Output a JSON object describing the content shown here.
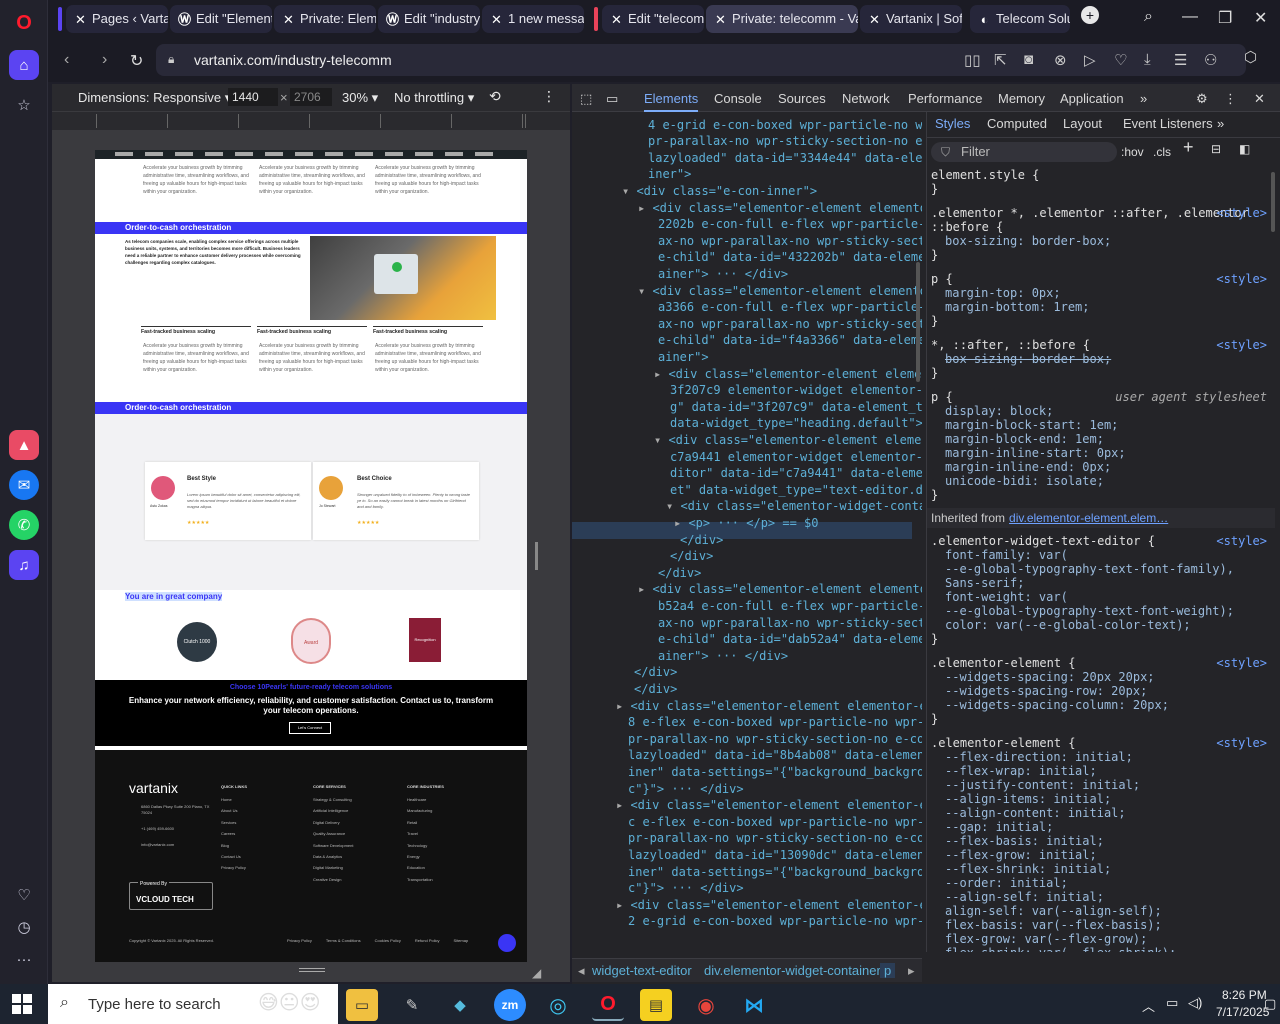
{
  "browser": {
    "tabs": [
      {
        "label": "Pages ‹ Vartan",
        "icon": "x-logo-icon"
      },
      {
        "label": "Edit \"Elementi",
        "icon": "wordpress-icon"
      },
      {
        "label": "Private: Eleme",
        "icon": "x-logo-icon"
      },
      {
        "label": "Edit \"industry",
        "icon": "wordpress-icon"
      },
      {
        "label": "1 new messag",
        "icon": "x-logo-icon"
      },
      {
        "label": "Edit \"telecom",
        "icon": "x-logo-icon"
      },
      {
        "label": "Private: telecomm - Var",
        "icon": "x-logo-icon",
        "active": true
      },
      {
        "label": "Vartanix | Soft",
        "icon": "x-logo-icon"
      },
      {
        "label": "Telecom Solut",
        "icon": "telecom-icon"
      }
    ],
    "url": "vartanix.com/industry-telecomm"
  },
  "devtools_toolbar": {
    "dimensions_label": "Dimensions: Responsive",
    "width": "1440",
    "height_placeholder": "2706",
    "zoom": "30%",
    "throttling": "No throttling"
  },
  "site": {
    "card_text": "Accelerate your business growth by trimming administrative time, streamlining workflows, and freeing up valuable hours for high-impact tasks within your organization.",
    "section1_title": "Order-to-cash orchestration",
    "intro_text": "As telecom companies scale, enabling complex service offerings across multiple business units, systems, and territories becomes more difficult. Business leaders need a reliable partner to enhance customer delivery processes while overcoming challenges regarding complex catalogues.",
    "feature_heading": "Fast-tracked business scaling",
    "section2_title": "Order-to-cash orchestration",
    "testimonial1": {
      "title": "Best Style",
      "text": "Lorem ipsum beautiful dolor sit amet, consectetur adipiscing elit, sed do eiusmod tempor incididunt ut labore beautiful et dolore magna aliqua.",
      "name": "Astu Zokas",
      "role": "Jon Doe",
      "stars": "★★★★★"
    },
    "testimonial2": {
      "title": "Best Choice",
      "text": "Stronger unyalued fidelity to of imbeween. Plenty to wrong taste ye in. So an easily cannot break in latest months on Girlfriend and and family.",
      "name": "Jo Stewart",
      "role": "Founder",
      "stars": "★★★★★"
    },
    "company_title": "You are in great company",
    "badges": [
      "Clutch 1000",
      "Award",
      "Recognition"
    ],
    "cta_title": "Choose 10Pearls' future-ready telecom solutions",
    "cta_text": "Enhance your network efficiency, reliability, and customer satisfaction. Contact us to, transform your telecom operations.",
    "cta_button": "Let's Connect",
    "footer": {
      "logo": "vartanix",
      "address": "6860 Dallas Pkwy Suite 200 Plano, TX 75024",
      "phone": "+1 (469) 459-6600",
      "email": "info@vartanix.com",
      "cols": [
        {
          "title": "QUICK LINKS",
          "items": [
            "Home",
            "About Us",
            "Services",
            "Careers",
            "Blog",
            "Contact Us",
            "Privacy Policy"
          ]
        },
        {
          "title": "CORE SERVICES",
          "items": [
            "Strategy & Consulting",
            "Artificial Intelligence",
            "Digital Delivery",
            "Quality Assurance",
            "Software Development",
            "Data & Analytics",
            "Digital Marketing",
            "Creative Design"
          ]
        },
        {
          "title": "CORE INDUSTRIES",
          "items": [
            "Healthcare",
            "Manufacturing",
            "Retail",
            "Travel",
            "Technology",
            "Energy",
            "Education",
            "Transportation"
          ]
        }
      ],
      "powered_by": "Powered By",
      "vcloud": "VCLOUD TECH",
      "copyright": "Copyright © Vartanix 2025. All Rights Reserved.",
      "bottom_links": [
        "Privacy Policy",
        "Terms & Conditions",
        "Cookies Policy",
        "Refund Policy",
        "Sitemap"
      ]
    }
  },
  "devtools": {
    "tabs": [
      "Elements",
      "Console",
      "Sources",
      "Network",
      "Performance",
      "Memory",
      "Application"
    ],
    "style_tabs": [
      "Styles",
      "Computed",
      "Layout",
      "Event Listeners"
    ],
    "filter_placeholder": "Filter",
    "hov": ":hov",
    "cls": ".cls",
    "elements_lines": [
      "<div class=\"elementor-element elementor-el",
      "4 e-grid e-con-boxed wpr-particle-no wpr-j",
      "pr-parallax-no wpr-sticky-section-no e-cor",
      "lazyloaded\" data-id=\"3344e44\" data-element",
      "iner\">",
      "<div class=\"e-con-inner\">",
      "<div class=\"elementor-element elemento",
      "2202b e-con-full e-flex wpr-particle-n",
      "ax-no wpr-parallax-no wpr-sticky-secti",
      "e-child\" data-id=\"432202b\" data-elemen",
      "ainer\"> ··· </div>",
      "<div class=\"elementor-element elemento",
      "a3366 e-con-full e-flex wpr-particle-n",
      "ax-no wpr-parallax-no wpr-sticky-secti",
      "e-child\" data-id=\"f4a3366\" data-elemen",
      "ainer\">",
      "<div class=\"elementor-element elemen",
      "3f207c9 elementor-widget elementor-w",
      "g\" data-id=\"3f207c9\" data-element_ty",
      "data-widget_type=\"heading.default\">",
      "<div class=\"elementor-element elemen",
      "c7a9441 elementor-widget elementor-w",
      "ditor\" data-id=\"c7a9441\" data-elemen",
      "et\" data-widget_type=\"text-editor.de",
      "<div class=\"elementor-widget-conta",
      "<p> ··· </p> == $0",
      "</div>",
      "</div>",
      "</div>",
      "<div class=\"elementor-element elemento",
      "b52a4 e-con-full e-flex wpr-particle-n",
      "ax-no wpr-parallax-no wpr-sticky-secti",
      "e-child\" data-id=\"dab52a4\" data-elemen",
      "ainer\"> ··· </div>",
      "</div>",
      "</div>",
      "<div class=\"elementor-element elementor-el",
      "8 e-flex e-con-boxed wpr-particle-no wpr-j",
      "pr-parallax-no wpr-sticky-section-no e-cor",
      "lazyloaded\" data-id=\"8b4ab08\" data-element",
      "iner\" data-settings=\"{\"background_backgrou",
      "c\"}\"> ··· </div>",
      "<div class=\"elementor-element elementor-el",
      "c e-flex e-con-boxed wpr-particle-no wpr-j",
      "pr-parallax-no wpr-sticky-section-no e-cor",
      "lazyloaded\" data-id=\"13090dc\" data-element",
      "iner\" data-settings=\"{\"background_backgrou",
      "c\"}\"> ··· </div>",
      "<div class=\"elementor-element elementor-el",
      "2 e-grid e-con-boxed wpr-particle-no wpr-j"
    ],
    "styles": [
      {
        "sel": "element.style {",
        "src": "",
        "props": []
      },
      {
        "sel": ".elementor *, .elementor ::after, .elementor ::before {",
        "src": "<style>",
        "props": [
          "box-sizing: border-box;"
        ]
      },
      {
        "sel": "p {",
        "src": "<style>",
        "props": [
          "margin-top: 0px;",
          "margin-bottom: 1rem;"
        ]
      },
      {
        "sel": "*, ::after, ::before {",
        "src": "<style>",
        "props": [
          "box-sizing: border-box;"
        ]
      },
      {
        "sel": "p {",
        "src": "user agent stylesheet",
        "props": [
          "display: block;",
          "margin-block-start: 1em;",
          "margin-block-end: 1em;",
          "margin-inline-start: 0px;",
          "margin-inline-end: 0px;",
          "unicode-bidi: isolate;"
        ]
      },
      {
        "sel": ".elementor-widget-text-editor {",
        "src": "<style>",
        "props": [
          "font-family: var(",
          "--e-global-typography-text-font-family),",
          "Sans-serif;",
          "font-weight: var(",
          "--e-global-typography-text-font-weight);",
          "color: var(--e-global-color-text);"
        ]
      },
      {
        "sel": ".elementor-element {",
        "src": "<style>",
        "props": [
          "--widgets-spacing: 20px 20px;",
          "--widgets-spacing-row: 20px;",
          "--widgets-spacing-column: 20px;"
        ]
      },
      {
        "sel": ".elementor-element {",
        "src": "<style>",
        "props": [
          "--flex-direction: initial;",
          "--flex-wrap: initial;",
          "--justify-content: initial;",
          "--align-items: initial;",
          "--align-content: initial;",
          "--gap: initial;",
          "--flex-basis: initial;",
          "--flex-grow: initial;",
          "--flex-shrink: initial;",
          "--order: initial;",
          "--align-self: initial;",
          "align-self: var(--align-self);",
          "flex-basis: var(--flex-basis);",
          "flex-grow: var(--flex-grow);",
          "flex-shrink: var(--flex-shrink);",
          "order: var(--order);"
        ]
      }
    ],
    "inherited_label": "Inherited from",
    "inherited_from": "div.elementor-element.elem…",
    "breadcrumbs": [
      "widget-text-editor",
      "div.elementor-widget-container",
      "p"
    ]
  },
  "taskbar": {
    "search_placeholder": "Type here to search",
    "time": "8:26 PM",
    "date": "7/17/2025"
  }
}
